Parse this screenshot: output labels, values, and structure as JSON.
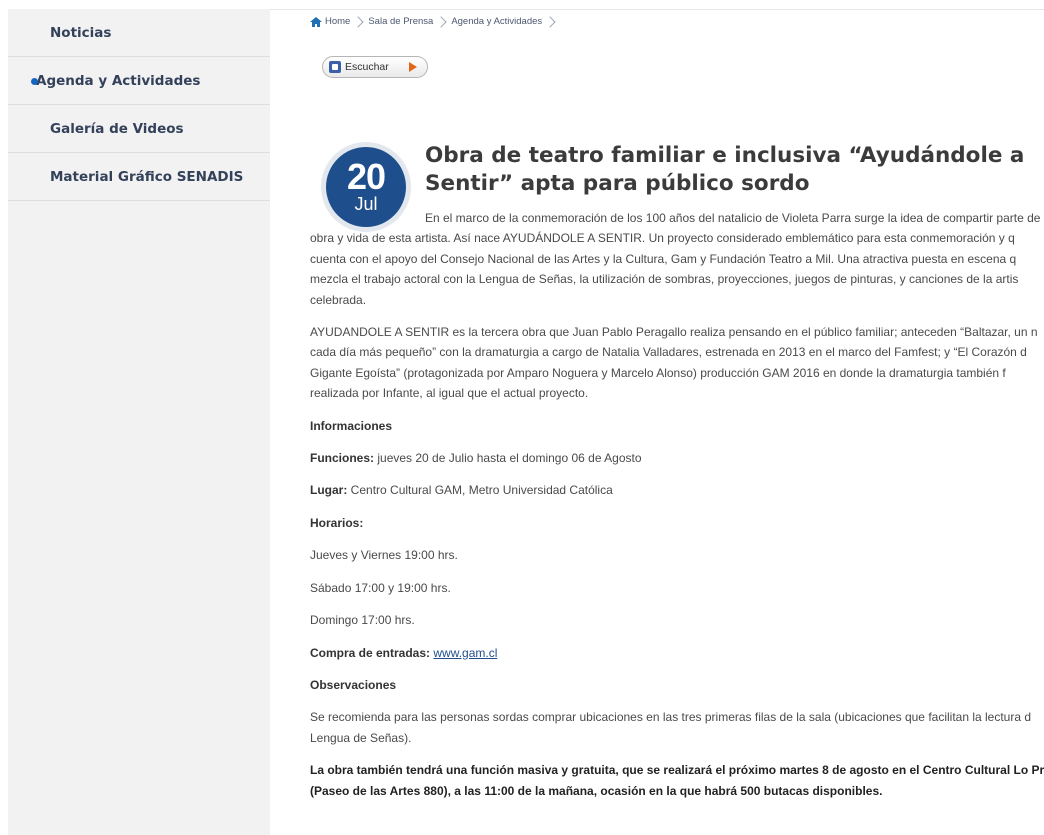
{
  "sidebar": {
    "items": [
      {
        "label": "Noticias",
        "active": false
      },
      {
        "label": "Agenda y Actividades",
        "active": true
      },
      {
        "label": "Galería de Videos",
        "active": false
      },
      {
        "label": "Material Gráfico SENADIS",
        "active": false
      }
    ]
  },
  "breadcrumb": {
    "home": "Home",
    "items": [
      "Sala de Prensa",
      "Agenda y Actividades"
    ]
  },
  "listen": {
    "label": "Escuchar"
  },
  "event": {
    "day": "20",
    "month": "Jul",
    "title": "Obra de teatro familiar e inclusiva “Ayudándole a Sentir” apta para público sordo"
  },
  "body": {
    "intro_lines": [
      "En el marco de la conmemoración de los 100 años del natalicio de Violeta Parra surge la idea de compartir parte de",
      "obra y vida de esta artista. Así nace AYUDÁNDOLE A SENTIR. Un proyecto considerado emblemático para esta conmemoración y q",
      "cuenta con el apoyo del Consejo Nacional de las Artes y la Cultura, Gam y Fundación Teatro a Mil. Una atractiva puesta en escena q",
      "mezcla el trabajo actoral con la Lengua de Señas, la utilización de sombras, proyecciones, juegos de pinturas, y canciones de la artis",
      "celebrada."
    ],
    "second_lines": [
      "AYUDANDOLE A SENTIR es la tercera obra que Juan Pablo Peragallo realiza pensando en el público familiar; anteceden “Baltazar, un n",
      "cada día más pequeño” con la dramaturgia a cargo de Natalia Valladares, estrenada en 2013 en el marco del Famfest; y “El Corazón d",
      "Gigante Egoísta” (protagonizada por Amparo Noguera y Marcelo Alonso) producción GAM 2016 en donde la dramaturgia también f",
      "realizada por Infante, al igual que el actual proyecto."
    ],
    "informaciones": "Informaciones",
    "funciones_label": "Funciones:",
    "funciones_value": " jueves 20 de Julio hasta el domingo 06 de Agosto",
    "lugar_label": "Lugar:",
    "lugar_value": " Centro Cultural GAM, Metro Universidad Católica",
    "horarios": "Horarios:",
    "horario_1": "Jueves y Viernes 19:00 hrs.",
    "horario_2": "Sábado  17:00 y 19:00 hrs.",
    "horario_3": "Domingo  17:00 hrs.",
    "compra_label": "Compra de entradas: ",
    "compra_link": "www.gam.cl",
    "observaciones": "Observaciones",
    "obs_lines": [
      "Se recomienda para las personas sordas comprar ubicaciones en las tres primeras filas de la sala (ubicaciones que facilitan la lectura d",
      "Lengua  de Señas)."
    ],
    "final_lines": [
      "La obra también tendrá una función masiva y gratuita, que se realizará el próximo martes 8 de agosto en el Centro Cultural Lo Pra",
      "(Paseo de las Artes 880), a las 11:00 de la mañana, ocasión en la que habrá 500 butacas disponibles."
    ]
  },
  "colors": {
    "accent": "#1f4e8c",
    "sidebar_bg": "#f2f2f2",
    "play": "#e2661a"
  }
}
